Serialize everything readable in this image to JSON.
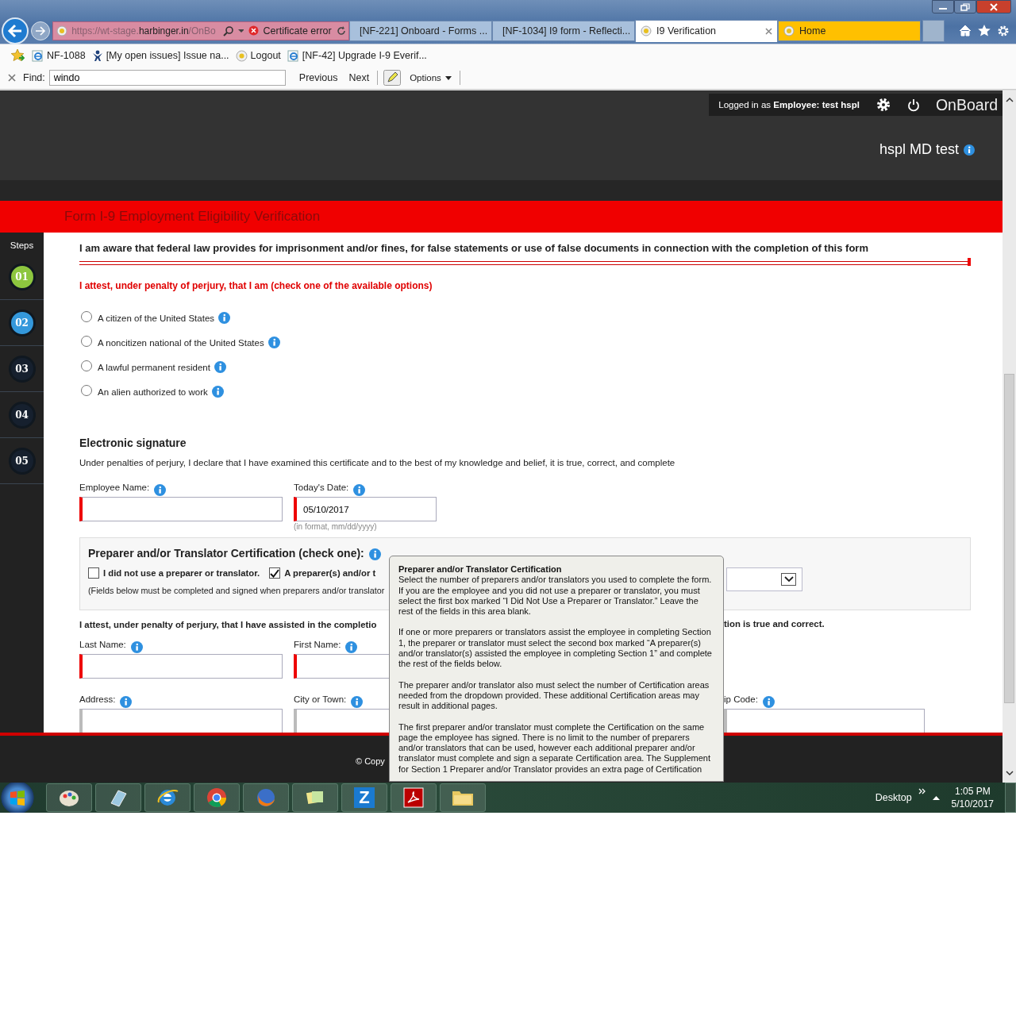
{
  "browser": {
    "address": {
      "url_start": "https://wt-stage.",
      "url_domain": "harbinger.in",
      "url_end": "/OnBo",
      "certificate": "Certificate error"
    },
    "tabs": [
      {
        "label": "[NF-221] Onboard - Forms ...",
        "kind": "jira",
        "selected": false,
        "color": "#a8c0dc"
      },
      {
        "label": "[NF-1034] I9 form - Reflecti...",
        "kind": "jira",
        "selected": false,
        "color": "#a8c0dc"
      },
      {
        "label": "I9 Verification",
        "kind": "site",
        "selected": true,
        "color": "#ffffff"
      },
      {
        "label": "Home",
        "kind": "site",
        "selected": false,
        "color": "#ffc000"
      }
    ],
    "favorites": [
      {
        "label": "NF-1088",
        "kind": "ie"
      },
      {
        "label": "[My open issues] Issue na...",
        "kind": "jira"
      },
      {
        "label": "Logout",
        "kind": "site"
      },
      {
        "label": "[NF-42] Upgrade I-9 Everif...",
        "kind": "ie"
      }
    ],
    "find_bar": {
      "label": "Find:",
      "value": "windo",
      "previous": "Previous",
      "next": "Next",
      "options": "Options"
    }
  },
  "header": {
    "logged_in": "Logged in as **Employee:  test hspl**",
    "brand": "OnBoard",
    "company": "hspl MD test"
  },
  "form_title": "Form I-9 Employment Eligibility Verification",
  "steps": {
    "label": "Steps",
    "items": [
      {
        "label": "01",
        "color": "#8dc63f"
      },
      {
        "label": "02",
        "color": "#3498db"
      },
      {
        "label": "03",
        "color": "#16202e"
      },
      {
        "label": "04",
        "color": "#16202e"
      },
      {
        "label": "05",
        "color": "#16202e"
      }
    ]
  },
  "warning": "I am aware that federal law provides for imprisonment and/or fines, for false statements or use of false documents in connection with the completion of this form",
  "attest": "I attest, under penalty of perjury, that I am (check one of the available options)",
  "options": [
    {
      "label": "A citizen of the United States",
      "selected": false
    },
    {
      "label": "A noncitizen national of the United States",
      "selected": false
    },
    {
      "label": "A lawful permanent resident",
      "selected": false
    },
    {
      "label": "An alien authorized to work",
      "selected": false
    }
  ],
  "signature": {
    "heading": "Electronic signature",
    "text": "Under penalties of perjury, I declare that I have examined this certificate and to the best of my knowledge and belief, it is true, correct, and complete",
    "employee_name": {
      "label": "Employee Name:"
    },
    "todays_date": {
      "label": "Today's Date:",
      "value": "05/10/2017",
      "hint": "(in format, mm/dd/yyyy)"
    }
  },
  "preparer": {
    "heading": "Preparer and/or Translator Certification (check one):",
    "checkboxes": [
      {
        "label": "I did not use a preparer or translator.",
        "checked": false
      },
      {
        "label": "A preparer(s) and/or t",
        "checked": true
      }
    ],
    "note": "(Fields below must be completed and signed when preparers and/or translator"
  },
  "attest2_start": "I attest, under penalty of perjury, that I have assisted in the completio",
  "attest2_end": "tion is true and correct.",
  "fields_row1": [
    {
      "label": "Last Name:"
    },
    {
      "label": "First Name:"
    }
  ],
  "fields_row2": [
    {
      "label": "Address:"
    },
    {
      "label": "City or Town:"
    }
  ],
  "zip_label": "ip Code:",
  "footer": "© Copy",
  "tooltip": {
    "title": "Preparer and/or Translator Certification",
    "paragraphs": [
      "Select the number of preparers and/or translators you used to complete the form. If you are the employee and you did not use a preparer or translator, you must select the first box marked “I Did Not Use a Preparer or Translator.” Leave the rest of the fields in this area blank.",
      "If one or more preparers or translators assist the employee in completing Section 1, the preparer or translator must select the second box marked “A preparer(s) and/or translator(s) assisted the employee in completing Section 1” and complete the rest of the fields below.",
      "The preparer and/or translator also must select the number of Certification areas needed from the dropdown provided. These additional Certification areas may result in additional pages.",
      "The first preparer and/or translator must complete the Certification on the same page the employee has signed. There is no limit to the number of preparers and/or translators that can be used, however each additional preparer and/or translator must complete and sign a separate Certification area. The Supplement for Section 1 Preparer and/or Translator provides an extra page of Certification"
    ]
  },
  "taskbar": {
    "apps": [
      {
        "kind": "paint"
      },
      {
        "kind": "notebook"
      },
      {
        "kind": "ie"
      },
      {
        "kind": "chrome"
      },
      {
        "kind": "firefox"
      },
      {
        "kind": "notes"
      },
      {
        "kind": "letter",
        "label": "Z"
      },
      {
        "kind": "pdf"
      },
      {
        "kind": "folder"
      }
    ],
    "desktop": "Desktop",
    "time": "1:05 PM",
    "date": "5/10/2017"
  }
}
